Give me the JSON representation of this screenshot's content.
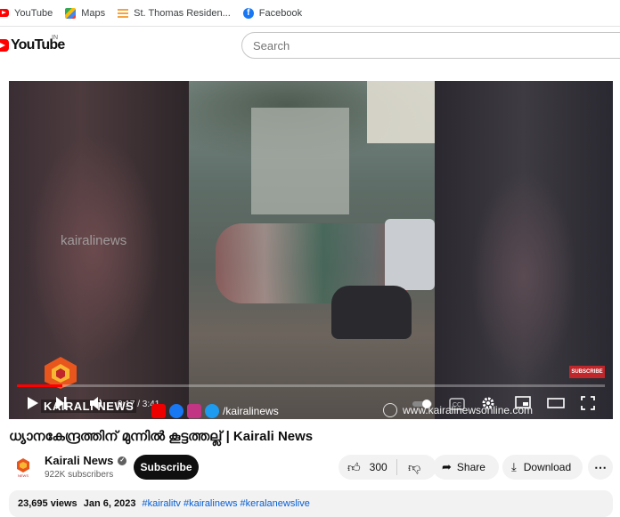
{
  "bookmarks": [
    {
      "label": "YouTube",
      "icon": "youtube-icon"
    },
    {
      "label": "Maps",
      "icon": "maps-icon"
    },
    {
      "label": "St. Thomas Residen...",
      "icon": "stacked-bars-icon"
    },
    {
      "label": "Facebook",
      "icon": "facebook-icon"
    }
  ],
  "masthead": {
    "logo_text": "YouTube",
    "country_code": "IN",
    "search_placeholder": "Search"
  },
  "player": {
    "watermark": "kairalinews",
    "subscribe_badge": "SUBSCRIBE",
    "time_current": "0:17",
    "time_total": "3:41",
    "time_display": "0:17 / 3:41",
    "progress": 0.077,
    "overlay_handle": "/kairalinews",
    "overlay_url": "www.kairalinewsonline.com",
    "overlay_brand": "KAIRALI NEWS",
    "brand_color": "#ff0000",
    "progress_color": "#ff0000"
  },
  "video": {
    "title": "ധ്യാനകേന്ദ്രത്തിന് മുന്നിൽ കൂട്ടത്തല്ല് | Kairali News",
    "channel_name": "Kairali News",
    "subscribers": "922K subscribers",
    "subscribe_label": "Subscribe",
    "likes": "300",
    "share_label": "Share",
    "download_label": "Download"
  },
  "description": {
    "views": "23,695 views",
    "date": "Jan 6, 2023",
    "tags": "#kairalitv #kairalinews #keralanewslive"
  }
}
